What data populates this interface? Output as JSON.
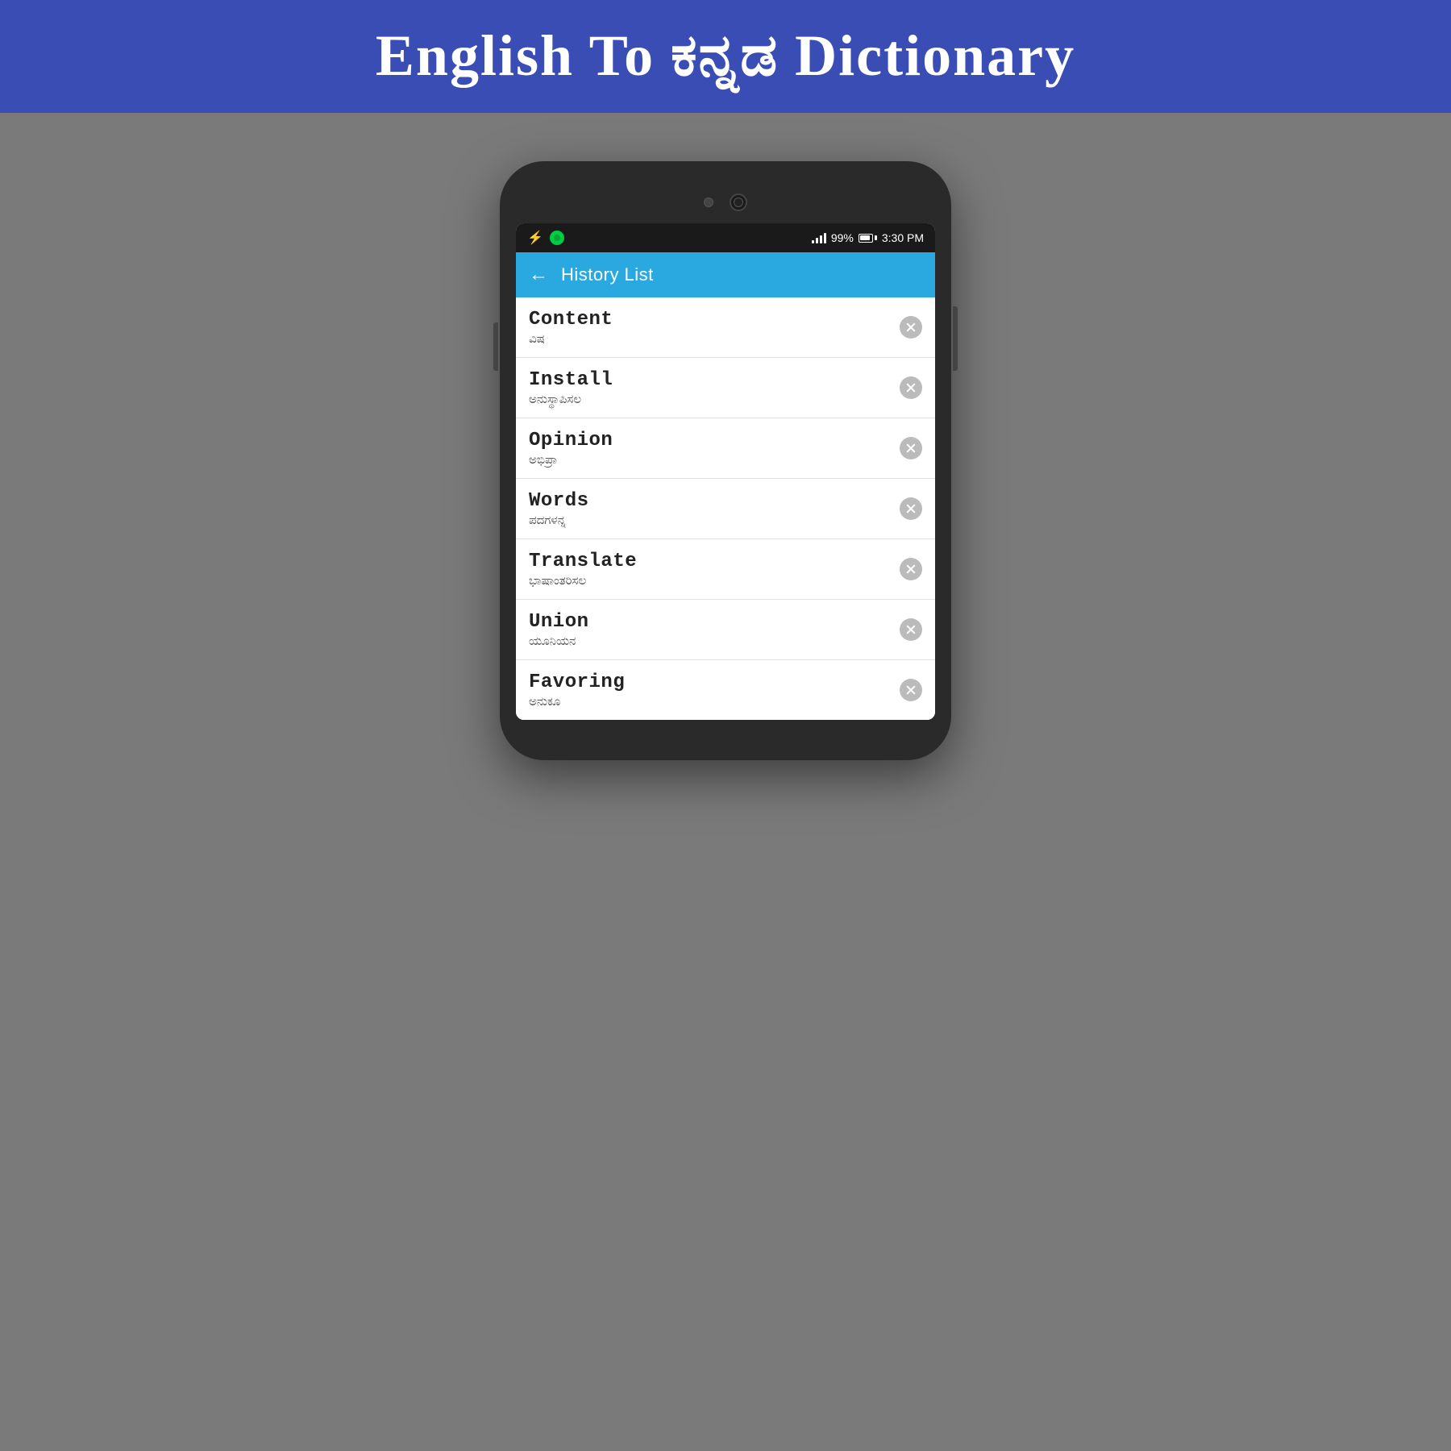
{
  "banner": {
    "title": "English To ಕನ್ನಡ  Dictionary"
  },
  "status_bar": {
    "battery_percent": "99%",
    "time": "3:30 PM"
  },
  "app_bar": {
    "back_label": "←",
    "title": "History List"
  },
  "list_items": [
    {
      "english": "Content",
      "kannada": "ವಿಷ"
    },
    {
      "english": "Install",
      "kannada": "ಅನುಸ್ಥಾಪಿಸಲ"
    },
    {
      "english": "Opinion",
      "kannada": "ಅಭಿಪ್ರಾ"
    },
    {
      "english": "Words",
      "kannada": "ಪದಗಳನ್ನ"
    },
    {
      "english": "Translate",
      "kannada": "ಭಾಷಾಂತರಿಸಲ"
    },
    {
      "english": "Union",
      "kannada": "ಯೂನಿಯನ"
    },
    {
      "english": "Favoring",
      "kannada": "ಅನುಕೂ"
    }
  ]
}
